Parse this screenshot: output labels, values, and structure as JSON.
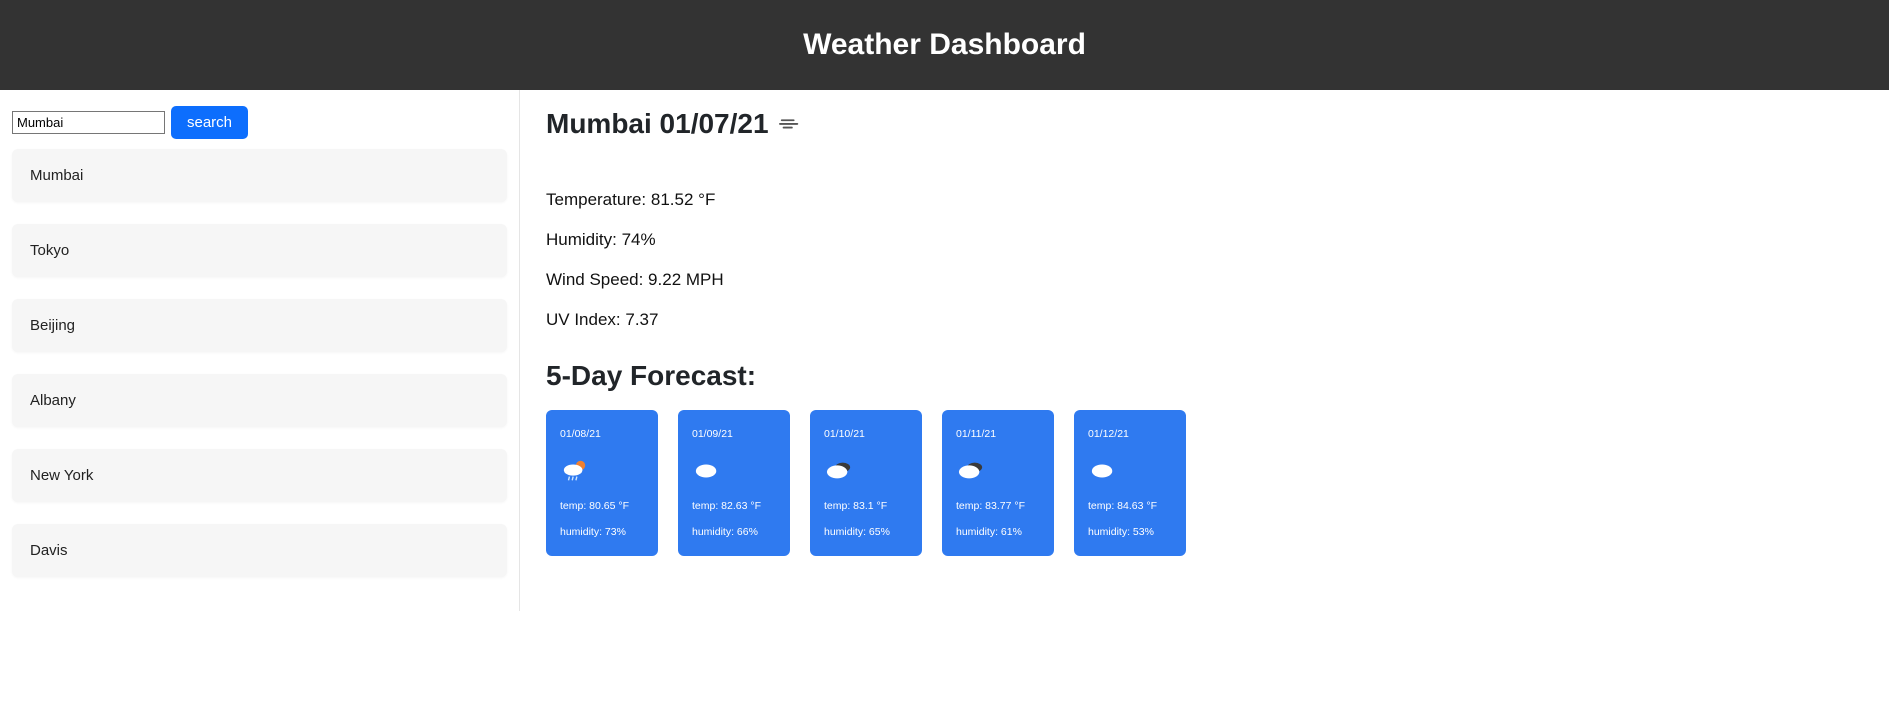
{
  "header": {
    "title": "Weather Dashboard"
  },
  "search": {
    "input_value": "Mumbai",
    "button_label": "search"
  },
  "history": [
    {
      "name": "Mumbai"
    },
    {
      "name": "Tokyo"
    },
    {
      "name": "Beijing"
    },
    {
      "name": "Albany"
    },
    {
      "name": "New York"
    },
    {
      "name": "Davis"
    }
  ],
  "current": {
    "title": "Mumbai 01/07/21",
    "icon": "wind",
    "temperature_label": "Temperature: 81.52 °F",
    "humidity_label": "Humidity: 74%",
    "wind_label": "Wind Speed: 9.22 MPH",
    "uv_label": "UV Index: 7.37"
  },
  "forecast": {
    "title": "5-Day Forecast:",
    "days": [
      {
        "date": "01/08/21",
        "icon": "few-clouds-rain",
        "temp": "temp: 80.65 °F",
        "humidity": "humidity: 73%"
      },
      {
        "date": "01/09/21",
        "icon": "cloud",
        "temp": "temp: 82.63 °F",
        "humidity": "humidity: 66%"
      },
      {
        "date": "01/10/21",
        "icon": "broken-clouds",
        "temp": "temp: 83.1 °F",
        "humidity": "humidity: 65%"
      },
      {
        "date": "01/11/21",
        "icon": "broken-clouds",
        "temp": "temp: 83.77 °F",
        "humidity": "humidity: 61%"
      },
      {
        "date": "01/12/21",
        "icon": "cloud",
        "temp": "temp: 84.63 °F",
        "humidity": "humidity: 53%"
      }
    ]
  }
}
